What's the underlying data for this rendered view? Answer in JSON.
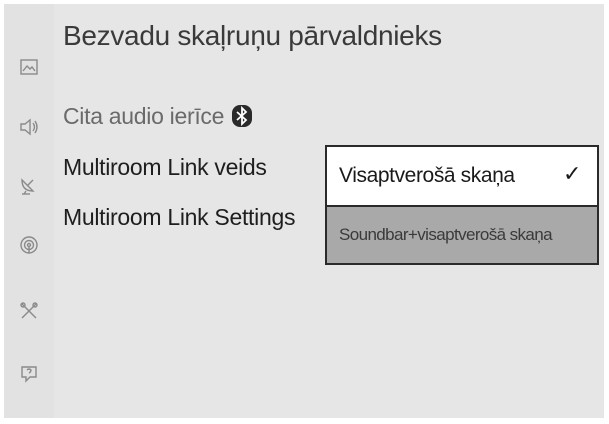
{
  "header": {
    "title": "Bezvadu skaļruņu pārvaldnieks"
  },
  "sidebar": {
    "items": [
      {
        "icon": "picture-icon"
      },
      {
        "icon": "speaker-icon"
      },
      {
        "icon": "satellite-dish-icon"
      },
      {
        "icon": "network-icon"
      },
      {
        "icon": "tools-icon"
      },
      {
        "icon": "support-icon"
      }
    ]
  },
  "menu": {
    "items": [
      {
        "label": "Cita audio ierīce",
        "icon": "bluetooth-icon",
        "state": "dimmed"
      },
      {
        "label": "Multiroom Link veids",
        "state": "normal"
      },
      {
        "label": "Multiroom Link Settings",
        "state": "normal"
      }
    ]
  },
  "dropdown": {
    "options": [
      {
        "label": "Visaptverošā skaņa",
        "selected": true,
        "check": "✓"
      },
      {
        "label": "Soundbar+visaptverošā skaņa",
        "selected": false
      }
    ]
  },
  "colors": {
    "panel_bg": "#e6e6e6",
    "highlight_bg": "#a9a9a9",
    "border": "#2a2a2a"
  }
}
